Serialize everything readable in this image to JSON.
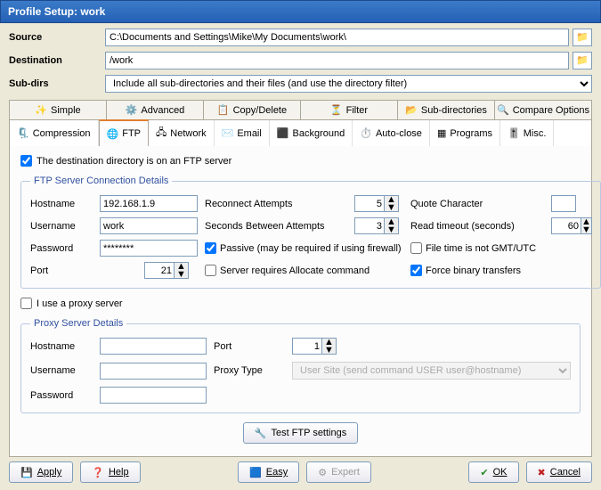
{
  "window": {
    "title": "Profile Setup: work"
  },
  "top": {
    "source_label": "Source",
    "source_value": "C:\\Documents and Settings\\Mike\\My Documents\\work\\",
    "dest_label": "Destination",
    "dest_value": "/work",
    "subdirs_label": "Sub-dirs",
    "subdirs_value": "Include all sub-directories and their files (and use the directory filter)"
  },
  "tabs": {
    "simple": "Simple",
    "advanced": "Advanced",
    "copydel": "Copy/Delete",
    "filter": "Filter",
    "subdirs": "Sub-directories",
    "compare": "Compare Options"
  },
  "subtabs": {
    "compression": "Compression",
    "ftp": "FTP",
    "network": "Network",
    "email": "Email",
    "background": "Background",
    "autoclose": "Auto-close",
    "programs": "Programs",
    "misc": "Misc."
  },
  "panel": {
    "dest_is_ftp": "The destination directory is on an FTP server",
    "group1_title": "FTP Server Connection Details",
    "hostname_l": "Hostname",
    "hostname_v": "192.168.1.9",
    "username_l": "Username",
    "username_v": "work",
    "password_l": "Password",
    "password_v": "********",
    "port_l": "Port",
    "port_v": "21",
    "reconnect_l": "Reconnect Attempts",
    "reconnect_v": "5",
    "seconds_l": "Seconds Between Attempts",
    "seconds_v": "3",
    "passive_l": "Passive (may be required if using firewall)",
    "alloc_l": "Server requires Allocate command",
    "quote_l": "Quote Character",
    "quote_v": "",
    "readto_l": "Read timeout (seconds)",
    "readto_v": "60",
    "gmt_l": "File time is not GMT/UTC",
    "binary_l": "Force binary transfers",
    "useproxy_l": "I use a proxy server",
    "group2_title": "Proxy Server Details",
    "p_host_l": "Hostname",
    "p_host_v": "",
    "p_user_l": "Username",
    "p_user_v": "",
    "p_pass_l": "Password",
    "p_pass_v": "",
    "p_port_l": "Port",
    "p_port_v": "1",
    "p_type_l": "Proxy Type",
    "p_type_v": "User Site (send command USER user@hostname)",
    "test_btn": "Test FTP settings"
  },
  "footer": {
    "apply": "Apply",
    "help": "Help",
    "easy": "Easy",
    "expert": "Expert",
    "ok": "OK",
    "cancel": "Cancel"
  }
}
